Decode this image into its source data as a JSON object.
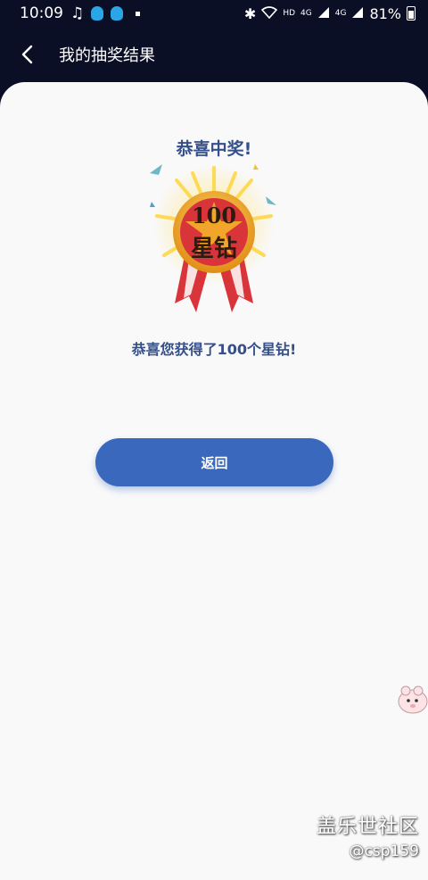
{
  "status_bar": {
    "time": "10:09",
    "notification_icons": [
      "music-note-icon",
      "qq-icon",
      "qq-icon"
    ],
    "hd_label": "HD",
    "network_1": "4G",
    "network_2": "4G",
    "battery": "81%"
  },
  "nav": {
    "title": "我的抽奖结果"
  },
  "result": {
    "title": "恭喜中奖!",
    "medal_line1": "100",
    "medal_line2": "星钻",
    "message": "恭喜您获得了100个星钻!"
  },
  "actions": {
    "return_label": "返回"
  },
  "watermark": {
    "main": "盖乐世社区",
    "sub": "@csp159"
  },
  "colors": {
    "header_bg": "#0b0f26",
    "card_bg": "#f9f9fa",
    "title_text": "#344f8a",
    "button_bg": "#3a68bd",
    "medal_red": "#d8343a",
    "medal_gold": "#f4b32a"
  }
}
